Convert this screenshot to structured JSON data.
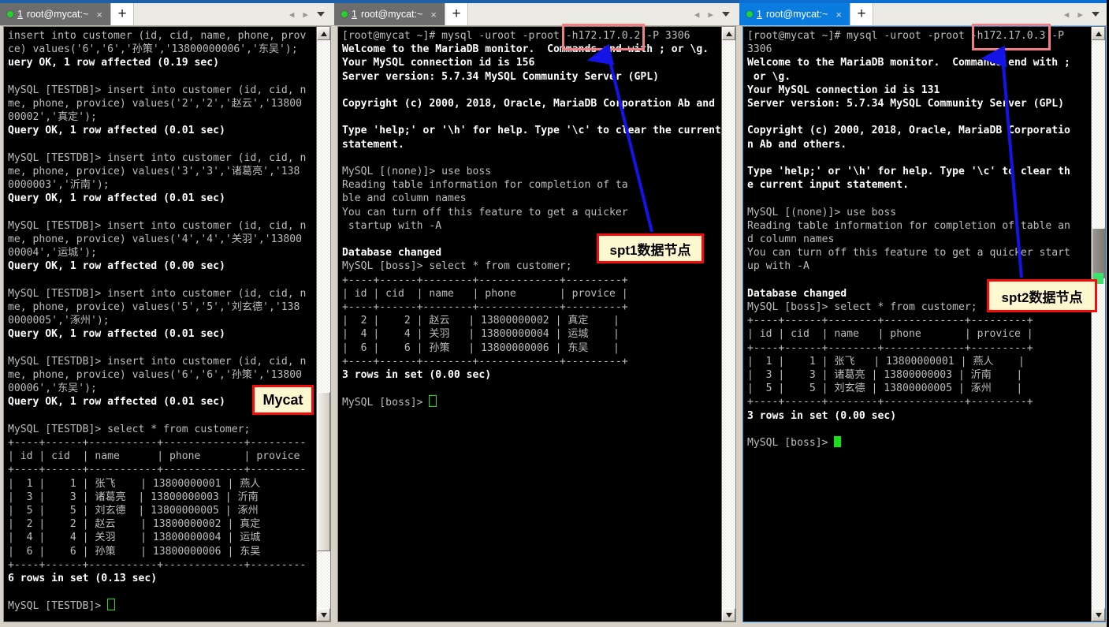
{
  "window": {
    "panes": [
      {
        "id": "mycat-proxy",
        "tab": {
          "number": "1",
          "title": "root@mycat:~",
          "close_label": "×",
          "new_tab_label": "+",
          "status_dot": "green-dot-icon",
          "active": false
        },
        "nav": {
          "prev": "◀",
          "next": "▶",
          "menu": "chevron-down-icon"
        },
        "terminal_lines": [
          {
            "text": "insert into customer (id, cid, name, phone, prov",
            "bold": false
          },
          {
            "text": "ce) values('6','6','孙策','13800000006','东吴');",
            "bold": false
          },
          {
            "text": "uery OK, 1 row affected (0.19 sec)",
            "bold": true
          },
          {
            "text": "",
            "bold": false
          },
          {
            "text": "MySQL [TESTDB]> insert into customer (id, cid, n",
            "bold": false
          },
          {
            "text": "me, phone, provice) values('2','2','赵云','13800",
            "bold": false
          },
          {
            "text": "00002','真定');",
            "bold": false
          },
          {
            "text": "Query OK, 1 row affected (0.01 sec)",
            "bold": true
          },
          {
            "text": "",
            "bold": false
          },
          {
            "text": "MySQL [TESTDB]> insert into customer (id, cid, n",
            "bold": false
          },
          {
            "text": "me, phone, provice) values('3','3','诸葛亮','138",
            "bold": false
          },
          {
            "text": "0000003','沂南');",
            "bold": false
          },
          {
            "text": "Query OK, 1 row affected (0.01 sec)",
            "bold": true
          },
          {
            "text": "",
            "bold": false
          },
          {
            "text": "MySQL [TESTDB]> insert into customer (id, cid, n",
            "bold": false
          },
          {
            "text": "me, phone, provice) values('4','4','关羽','13800",
            "bold": false
          },
          {
            "text": "00004','运城');",
            "bold": false
          },
          {
            "text": "Query OK, 1 row affected (0.00 sec)",
            "bold": true
          },
          {
            "text": "",
            "bold": false
          },
          {
            "text": "MySQL [TESTDB]> insert into customer (id, cid, n",
            "bold": false
          },
          {
            "text": "me, phone, provice) values('5','5','刘玄德','138",
            "bold": false
          },
          {
            "text": "0000005','涿州');",
            "bold": false
          },
          {
            "text": "Query OK, 1 row affected (0.01 sec)",
            "bold": true
          },
          {
            "text": "",
            "bold": false
          },
          {
            "text": "MySQL [TESTDB]> insert into customer (id, cid, n",
            "bold": false
          },
          {
            "text": "me, phone, provice) values('6','6','孙策','13800",
            "bold": false
          },
          {
            "text": "00006','东吴');",
            "bold": false
          },
          {
            "text": "Query OK, 1 row affected (0.01 sec)",
            "bold": true
          },
          {
            "text": "",
            "bold": false
          },
          {
            "text": "MySQL [TESTDB]> select * from customer;",
            "bold": false
          },
          {
            "text": "+----+------+-----------+-------------+---------",
            "bold": false
          },
          {
            "text": "| id | cid  | name      | phone       | provice",
            "bold": false
          },
          {
            "text": "+----+------+-----------+-------------+---------",
            "bold": false
          },
          {
            "text": "|  1 |    1 | 张飞    | 13800000001 | 燕人",
            "bold": false
          },
          {
            "text": "|  3 |    3 | 诸葛亮  | 13800000003 | 沂南",
            "bold": false
          },
          {
            "text": "|  5 |    5 | 刘玄德  | 13800000005 | 涿州",
            "bold": false
          },
          {
            "text": "|  2 |    2 | 赵云    | 13800000002 | 真定",
            "bold": false
          },
          {
            "text": "|  4 |    4 | 关羽    | 13800000004 | 运城",
            "bold": false
          },
          {
            "text": "|  6 |    6 | 孙策    | 13800000006 | 东吴",
            "bold": false
          },
          {
            "text": "+----+------+-----------+-------------+---------",
            "bold": false
          },
          {
            "text": "6 rows in set (0.13 sec)",
            "bold": true
          },
          {
            "text": "",
            "bold": false
          },
          {
            "text": "MySQL [TESTDB]> ",
            "bold": false,
            "cursor": "hollow"
          }
        ]
      },
      {
        "id": "spt1-node",
        "tab": {
          "number": "1",
          "title": "root@mycat:~",
          "close_label": "×",
          "new_tab_label": "+",
          "status_dot": "green-dot-icon",
          "active": false
        },
        "nav": {
          "prev": "◀",
          "next": "▶",
          "menu": "chevron-down-icon"
        },
        "terminal_lines": [
          {
            "text": "[root@mycat ~]# mysql -uroot -proot -h172.17.0.2 -P 3306",
            "bold": false
          },
          {
            "text": "Welcome to the MariaDB monitor.  Commands end with ; or \\g.",
            "bold": true
          },
          {
            "text": "Your MySQL connection id is 156",
            "bold": true
          },
          {
            "text": "Server version: 5.7.34 MySQL Community Server (GPL)",
            "bold": true
          },
          {
            "text": "",
            "bold": false
          },
          {
            "text": "Copyright (c) 2000, 2018, Oracle, MariaDB Corporation Ab and",
            "bold": true
          },
          {
            "text": "",
            "bold": false
          },
          {
            "text": "Type 'help;' or '\\h' for help. Type '\\c' to clear the current",
            "bold": true
          },
          {
            "text": "statement.",
            "bold": true
          },
          {
            "text": "",
            "bold": false
          },
          {
            "text": "MySQL [(none)]> use boss",
            "bold": false
          },
          {
            "text": "Reading table information for completion of ta",
            "bold": false
          },
          {
            "text": "ble and column names",
            "bold": false
          },
          {
            "text": "You can turn off this feature to get a quicker",
            "bold": false
          },
          {
            "text": " startup with -A",
            "bold": false
          },
          {
            "text": "",
            "bold": false
          },
          {
            "text": "Database changed",
            "bold": true
          },
          {
            "text": "MySQL [boss]> select * from customer;",
            "bold": false
          },
          {
            "text": "+----+------+--------+-------------+---------+",
            "bold": false
          },
          {
            "text": "| id | cid  | name   | phone       | provice |",
            "bold": false
          },
          {
            "text": "+----+------+--------+-------------+---------+",
            "bold": false
          },
          {
            "text": "|  2 |    2 | 赵云   | 13800000002 | 真定    |",
            "bold": false
          },
          {
            "text": "|  4 |    4 | 关羽   | 13800000004 | 运城    |",
            "bold": false
          },
          {
            "text": "|  6 |    6 | 孙策   | 13800000006 | 东吴    |",
            "bold": false
          },
          {
            "text": "+----+------+--------+-------------+---------+",
            "bold": false
          },
          {
            "text": "3 rows in set (0.00 sec)",
            "bold": true
          },
          {
            "text": "",
            "bold": false
          },
          {
            "text": "MySQL [boss]> ",
            "bold": false,
            "cursor": "hollow"
          }
        ]
      },
      {
        "id": "spt2-node",
        "tab": {
          "number": "1",
          "title": "root@mycat:~",
          "close_label": "×",
          "new_tab_label": "+",
          "status_dot": "green-dot-icon",
          "active": true
        },
        "nav": {
          "prev": "◀",
          "next": "▶",
          "menu": "chevron-down-icon"
        },
        "terminal_lines": [
          {
            "text": "[root@mycat ~]# mysql -uroot -proot -h172.17.0.3 -P",
            "bold": false
          },
          {
            "text": "3306",
            "bold": false
          },
          {
            "text": "Welcome to the MariaDB monitor.  Commands end with ;",
            "bold": true
          },
          {
            "text": " or \\g.",
            "bold": true
          },
          {
            "text": "Your MySQL connection id is 131",
            "bold": true
          },
          {
            "text": "Server version: 5.7.34 MySQL Community Server (GPL)",
            "bold": true
          },
          {
            "text": "",
            "bold": false
          },
          {
            "text": "Copyright (c) 2000, 2018, Oracle, MariaDB Corporatio",
            "bold": true
          },
          {
            "text": "n Ab and others.",
            "bold": true
          },
          {
            "text": "",
            "bold": false
          },
          {
            "text": "Type 'help;' or '\\h' for help. Type '\\c' to clear th",
            "bold": true
          },
          {
            "text": "e current input statement.",
            "bold": true
          },
          {
            "text": "",
            "bold": false
          },
          {
            "text": "MySQL [(none)]> use boss",
            "bold": false
          },
          {
            "text": "Reading table information for completion of table an",
            "bold": false
          },
          {
            "text": "d column names",
            "bold": false
          },
          {
            "text": "You can turn off this feature to get a quicker start",
            "bold": false
          },
          {
            "text": "up with -A",
            "bold": false
          },
          {
            "text": "",
            "bold": false
          },
          {
            "text": "Database changed",
            "bold": true
          },
          {
            "text": "MySQL [boss]> select * from customer;",
            "bold": false
          },
          {
            "text": "+----+------+--------+-------------+---------+",
            "bold": false
          },
          {
            "text": "| id | cid  | name   | phone       | provice |",
            "bold": false
          },
          {
            "text": "+----+------+--------+-------------+---------+",
            "bold": false
          },
          {
            "text": "|  1 |    1 | 张飞   | 13800000001 | 燕人    |",
            "bold": false
          },
          {
            "text": "|  3 |    3 | 诸葛亮 | 13800000003 | 沂南    |",
            "bold": false
          },
          {
            "text": "|  5 |    5 | 刘玄德 | 13800000005 | 涿州    |",
            "bold": false
          },
          {
            "text": "+----+------+--------+-------------+---------+",
            "bold": false
          },
          {
            "text": "3 rows in set (0.00 sec)",
            "bold": true
          },
          {
            "text": "",
            "bold": false
          },
          {
            "text": "MySQL [boss]> ",
            "bold": false,
            "cursor": "solid"
          }
        ]
      }
    ]
  },
  "annotations": {
    "mycat": {
      "label": "Mycat",
      "border_color": "#f40c0c",
      "fill_color": "#fdf8d0"
    },
    "spt1": {
      "label": "spt1数据节点",
      "border_color": "#f40c0c",
      "fill_color": "#fdf8d0"
    },
    "spt2": {
      "label": "spt2数据节点",
      "border_color": "#f40c0c",
      "fill_color": "#fdf8d0"
    },
    "highlights": [
      {
        "target": "-h172.17.0.2",
        "color": "#ef7f81"
      },
      {
        "target": "-h172.17.0.3",
        "color": "#ef7f81"
      }
    ],
    "arrow_color": "#1414e6"
  }
}
